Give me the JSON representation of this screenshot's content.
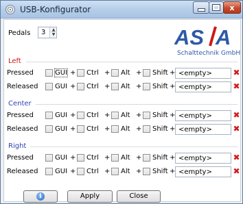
{
  "window": {
    "title": "USB-Konfigurator",
    "minimize_glyph": "_",
    "maximize_glyph": "□",
    "close_glyph": "x"
  },
  "pedals": {
    "label": "Pedals",
    "value": "3"
  },
  "logo": {
    "text": "AS/A",
    "subtitle": "Schalttechnik GmbH",
    "brand_color": "#2d59a8"
  },
  "sections": [
    {
      "title": "Left",
      "rows": [
        {
          "label": "Pressed",
          "key": "<empty>"
        },
        {
          "label": "Released",
          "key": "<empty>"
        }
      ]
    },
    {
      "title": "Center",
      "rows": [
        {
          "label": "Pressed",
          "key": "<empty>"
        },
        {
          "label": "Released",
          "key": "<empty>"
        }
      ]
    },
    {
      "title": "Right",
      "rows": [
        {
          "label": "Pressed",
          "key": "<empty>"
        },
        {
          "label": "Released",
          "key": "<empty>"
        }
      ]
    }
  ],
  "modifiers": [
    "GUI",
    "Ctrl",
    "Alt",
    "Shift"
  ],
  "plus": "+",
  "clear_glyph": "✖",
  "buttons": {
    "info_glyph": "i",
    "apply": "Apply",
    "close": "Close"
  },
  "colors": {
    "section_left": "#cc1a1a",
    "section_other": "#2a43b3",
    "clear": "#d11b1b"
  }
}
